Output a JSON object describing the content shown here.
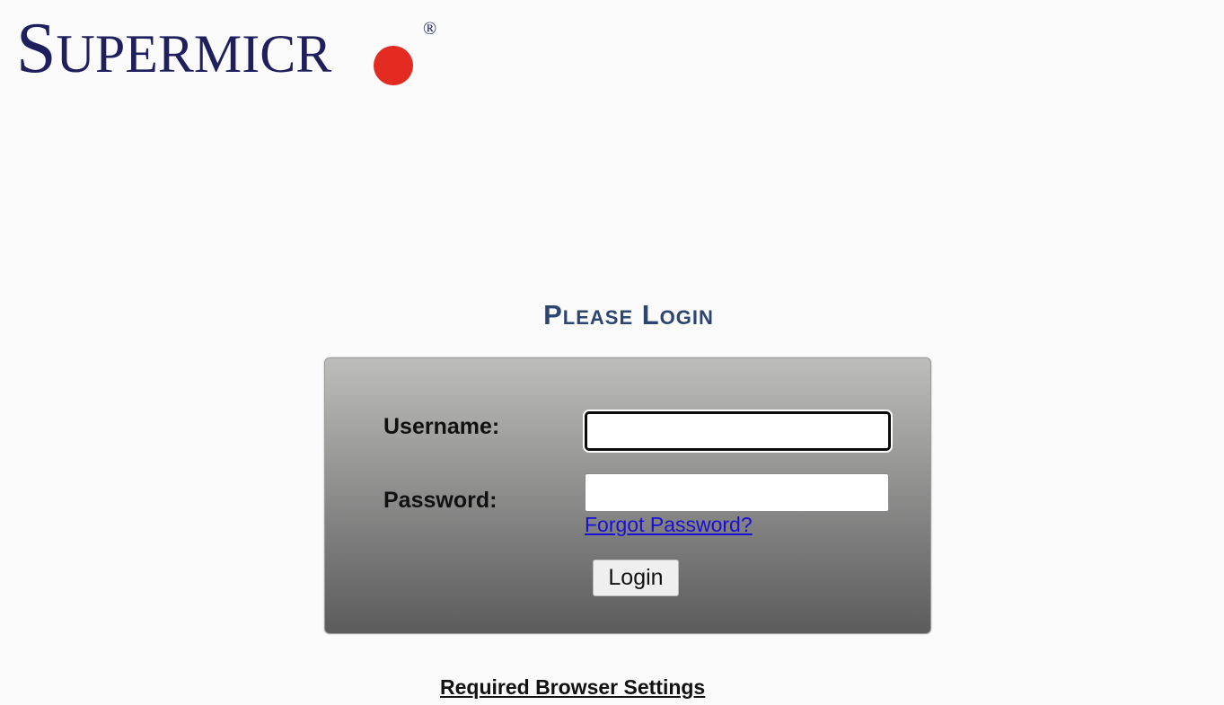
{
  "logo": {
    "first_letter": "S",
    "rest_letters": "UPERMICR",
    "registered_mark": "®",
    "brand_color": "#1f1f5e",
    "dot_color": "#e32b21"
  },
  "title": "Please Login",
  "form": {
    "username_label": "Username:",
    "username_value": "",
    "password_label": "Password:",
    "password_value": "",
    "forgot_password_link": "Forgot Password?",
    "login_button": "Login"
  },
  "footer": {
    "browser_settings_link": "Required Browser Settings"
  },
  "colors": {
    "title": "#2d4571",
    "link": "#1a0dd6",
    "panel_top": "#bdbdbb",
    "panel_bottom": "#5c5c5c"
  }
}
